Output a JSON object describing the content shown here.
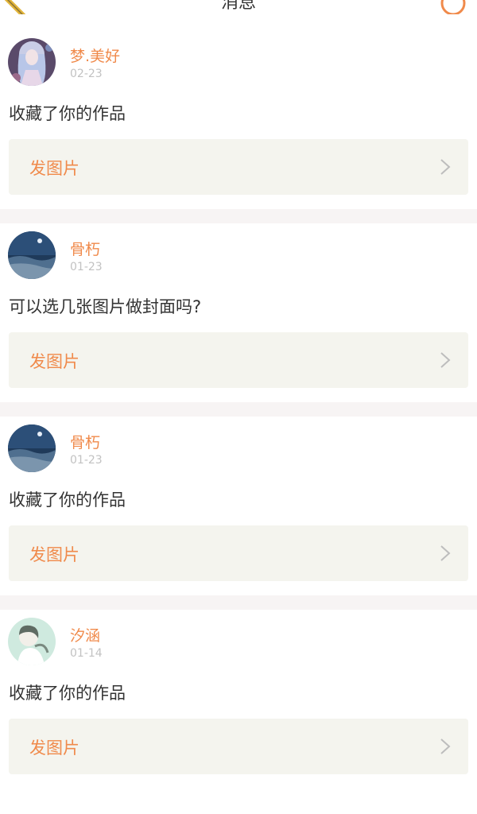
{
  "header": {
    "title": "消息"
  },
  "messages": [
    {
      "username": "梦.美好",
      "date": "02-23",
      "text": "收藏了你的作品",
      "action_label": "发图片",
      "avatar": "anime-girl-avatar"
    },
    {
      "username": "骨朽",
      "date": "01-23",
      "text": "可以选几张图片做封面吗?",
      "action_label": "发图片",
      "avatar": "night-sky-avatar"
    },
    {
      "username": "骨朽",
      "date": "01-23",
      "text": "收藏了你的作品",
      "action_label": "发图片",
      "avatar": "night-sky-avatar"
    },
    {
      "username": "汐涵",
      "date": "01-14",
      "text": "收藏了你的作品",
      "action_label": "发图片",
      "avatar": "mint-girl-avatar"
    }
  ],
  "colors": {
    "accent": "#f08a4b",
    "action_bg": "#f4f4ee",
    "separator": "#f7f4f4"
  }
}
